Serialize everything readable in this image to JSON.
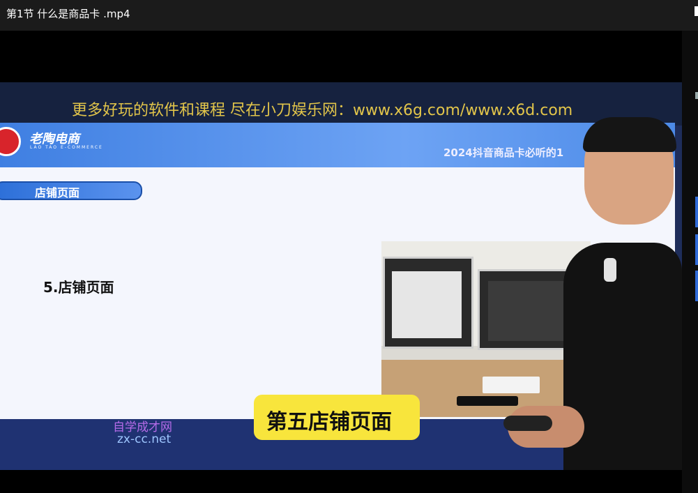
{
  "window": {
    "title": "第1节 什么是商品卡 .mp4"
  },
  "video": {
    "banner": "更多好玩的软件和课程 尽在小刀娱乐网：www.x6g.com/www.x6d.com",
    "logo": {
      "name": "老陶电商",
      "subtitle": "LAO TAO E-COMMERCE"
    },
    "header_title": "2024抖音商品卡必听的1",
    "section_pill": "店铺页面",
    "main_item": "5.店铺页面",
    "subtitle_caption": "第五店铺页面",
    "watermark": {
      "line1": "自学成才网",
      "line2": "zx-cc.net"
    }
  }
}
